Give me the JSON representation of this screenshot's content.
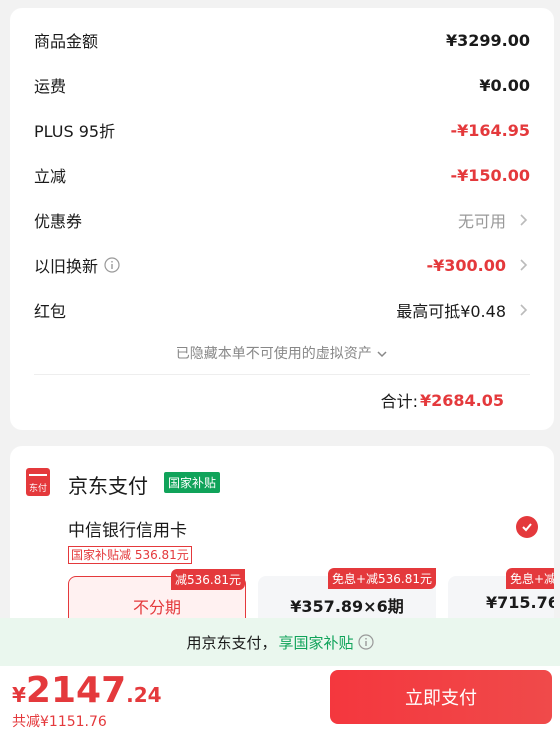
{
  "summary": {
    "rows": [
      {
        "label": "商品金额",
        "value": "¥3299.00",
        "color": "#1a1a1a"
      },
      {
        "label": "运费",
        "value": "¥0.00",
        "color": "#1a1a1a"
      },
      {
        "label": "PLUS 95折",
        "value": "-¥164.95",
        "color": "#e4393c"
      },
      {
        "label": "立减",
        "value": "-¥150.00",
        "color": "#e4393c"
      },
      {
        "label": "优惠券",
        "value": "无可用",
        "color": "#999999"
      },
      {
        "label": "以旧换新",
        "value": "-¥300.00",
        "color": "#e4393c"
      },
      {
        "label": "红包",
        "value": "最高可抵¥0.48",
        "color": "#1a1a1a"
      }
    ],
    "hidden_note": "已隐藏本单不可使用的虚拟资产",
    "total_label": "合计:",
    "total_value": "¥2684.05"
  },
  "payment": {
    "title": "京东支付",
    "logo_text": "东付",
    "subsidy_tag": "国家补贴",
    "bank_name": "中信银行信用卡",
    "bank_subsidy": "国家补贴减 536.81元",
    "options": [
      {
        "label": "不分期",
        "tag": "减536.81元"
      },
      {
        "label": "¥357.89×6期",
        "tag": "免息+减536.81元"
      },
      {
        "label": "¥715.76×",
        "tag": "免息+减"
      }
    ]
  },
  "banner": {
    "text": "用京东支付，",
    "highlight": "享国家补贴"
  },
  "footer": {
    "currency": "¥",
    "price_int": "2147",
    "price_dec": ".24",
    "saved": "共减¥1151.76",
    "pay_button": "立即支付"
  },
  "colors": {
    "accent": "#e4393c",
    "green": "#10a35a"
  }
}
